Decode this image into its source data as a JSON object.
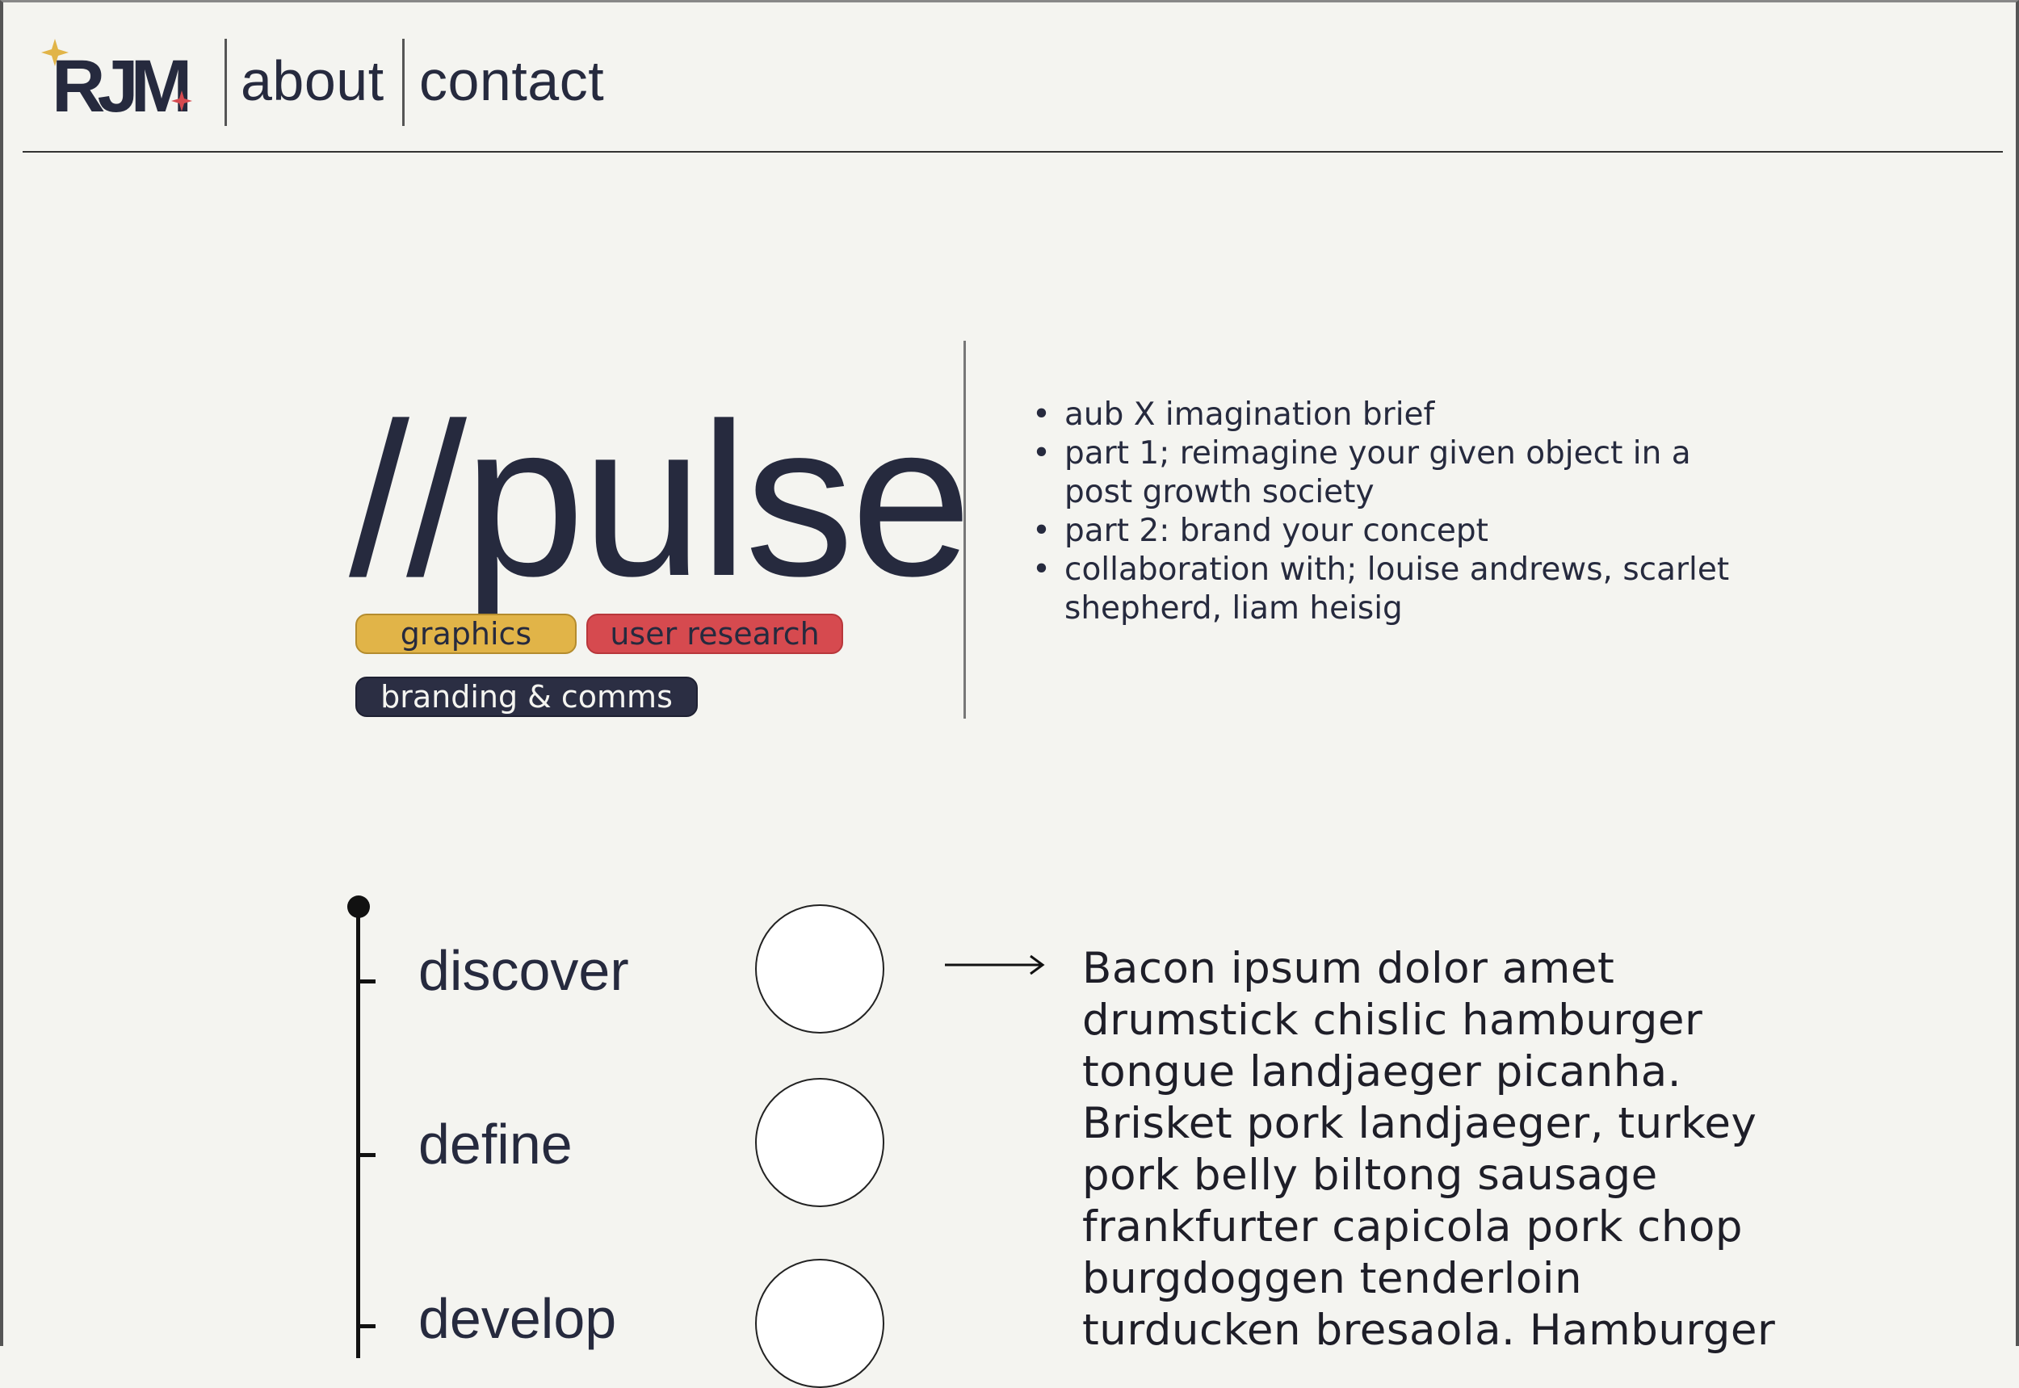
{
  "header": {
    "logo_text": "RJM",
    "nav": [
      {
        "label": "about"
      },
      {
        "label": "contact"
      }
    ]
  },
  "project": {
    "title": "//pulse",
    "tags": [
      {
        "label": "graphics",
        "color": "#e1b448"
      },
      {
        "label": "user research",
        "color": "#d64a4f"
      },
      {
        "label": "branding & comms",
        "color": "#2b2e43"
      }
    ],
    "brief_points": [
      "aub X imagination brief",
      "part 1; reimagine your given object in a post growth society",
      "part 2: brand your concept",
      "collaboration with; louise andrews, scarlet shepherd, liam heisig"
    ]
  },
  "process": {
    "steps": [
      {
        "label": "discover"
      },
      {
        "label": "define"
      },
      {
        "label": "develop"
      }
    ],
    "description": "Bacon ipsum dolor amet drumstick chislic hamburger tongue landjaeger picanha. Brisket pork landjaeger, turkey pork belly biltong sausage frankfurter capicola pork chop burgdoggen tenderloin turducken bresaola. Hamburger"
  },
  "colors": {
    "background": "#f4f4f0",
    "ink": "#262a3e",
    "accent_gold": "#e1b448",
    "accent_red": "#d64a4f"
  }
}
